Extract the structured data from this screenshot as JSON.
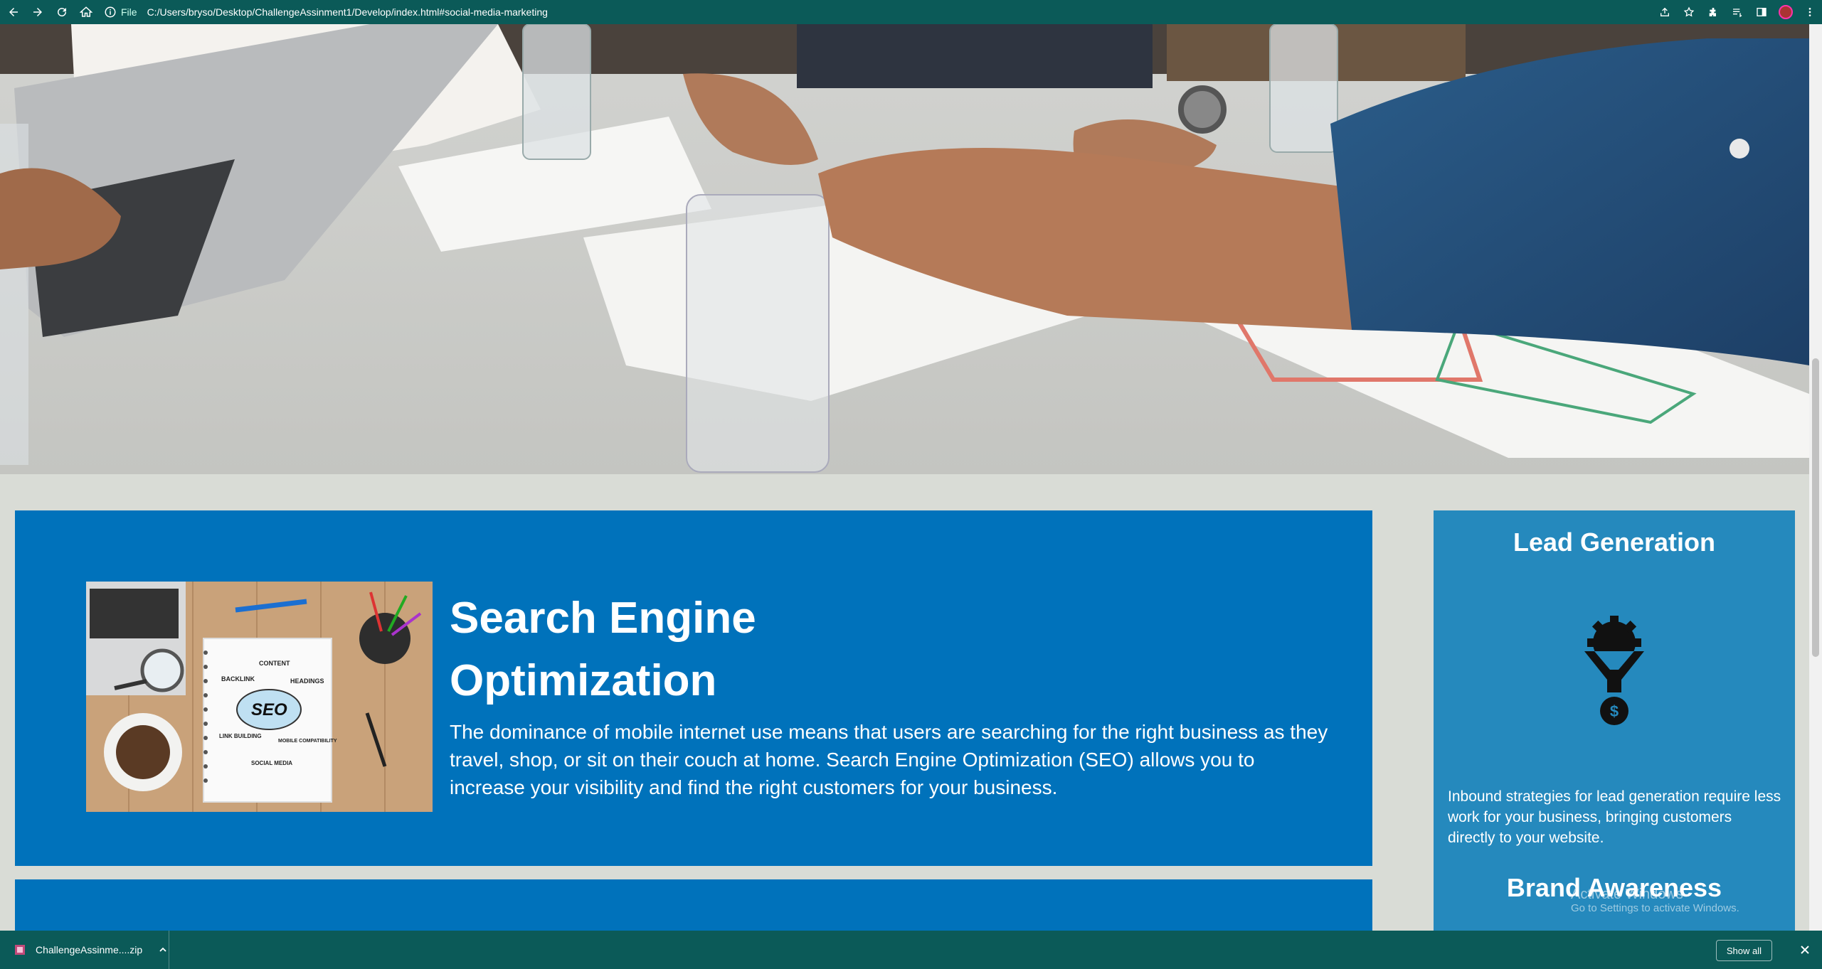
{
  "browser": {
    "file_label": "File",
    "url": "C:/Users/bryso/Desktop/ChallengeAssinment1/Develop/index.html#social-media-marketing"
  },
  "seo": {
    "title": "Search Engine Optimization",
    "text": "The dominance of mobile internet use means that users are searching for the right business as they travel, shop, or sit on their couch at home. Search Engine Optimization (SEO) allows you to increase your visibility and find the right customers for your business.",
    "image_words": [
      "CONTENT",
      "BACKLINK",
      "HEADINGS",
      "SEO",
      "LINK BUILDING",
      "MOBILE COMPATIBILITY",
      "SOCIAL MEDIA"
    ]
  },
  "aside": {
    "lead_title": "Lead Generation",
    "lead_text": "Inbound strategies for lead generation require less work for your business, bringing customers directly to your website.",
    "brand_title": "Brand Awareness"
  },
  "windows_watermark": {
    "line1": "Activate Windows",
    "line2": "Go to Settings to activate Windows."
  },
  "downloads": {
    "file_name": "ChallengeAssinme....zip",
    "show_all": "Show all"
  },
  "colors": {
    "chrome": "#0b5a58",
    "seo_card": "#0072bb",
    "aside": "#2589bd",
    "page_bg": "#d9dcd6"
  },
  "icons": [
    "back-icon",
    "forward-icon",
    "reload-icon",
    "home-icon",
    "info-icon",
    "share-icon",
    "star-icon",
    "extensions-icon",
    "reading-list-icon",
    "side-panel-icon",
    "profile-avatar",
    "menu-icon",
    "lead-funnel-icon",
    "zip-file-icon",
    "chevron-up-icon",
    "close-icon"
  ]
}
